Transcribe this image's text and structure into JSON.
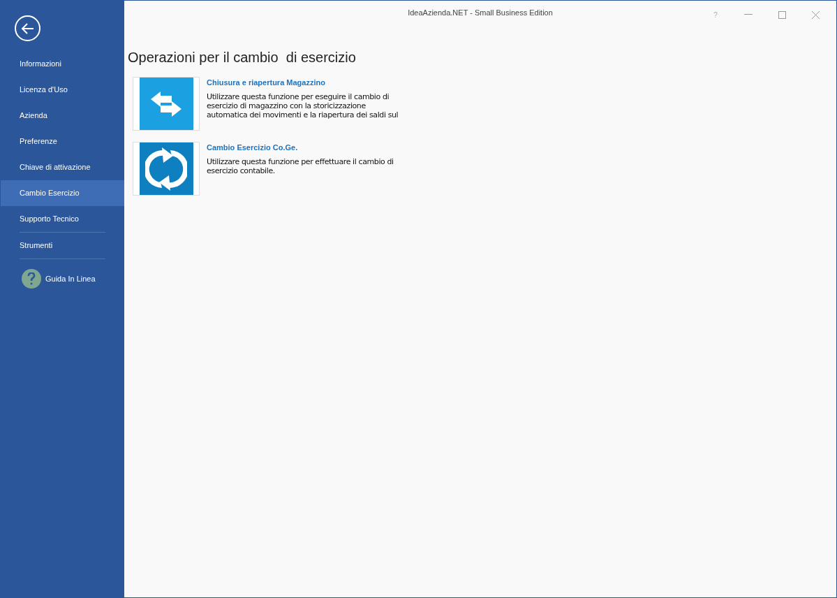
{
  "window": {
    "title": "IdeaAzienda.NET - Small Business Edition",
    "help_button": "?"
  },
  "sidebar": {
    "items": [
      {
        "label": "Informazioni",
        "selected": false,
        "divider_below": false
      },
      {
        "label": "Licenza d'Uso",
        "selected": false,
        "divider_below": false
      },
      {
        "label": "Azienda",
        "selected": false,
        "divider_below": false
      },
      {
        "label": "Preferenze",
        "selected": false,
        "divider_below": false
      },
      {
        "label": "Chiave di attivazione",
        "selected": false,
        "divider_below": false
      },
      {
        "label": "Cambio Esercizio",
        "selected": true,
        "divider_below": false
      },
      {
        "label": "Supporto Tecnico",
        "selected": false,
        "divider_below": true
      },
      {
        "label": "Strumenti",
        "selected": false,
        "divider_below": true
      }
    ],
    "help_link": "Guida In Linea"
  },
  "content": {
    "heading": "Operazioni per il cambio  di esercizio",
    "operations": [
      {
        "kind": "swap",
        "title": "Chiusura e riapertura Magazzino",
        "description": "Utilizzare questa funzione per eseguire il cambio di esercizio di magazzino con la storicizzazione automatica dei movimenti e la riapertura dei saldi sul"
      },
      {
        "kind": "refresh",
        "title": "Cambio Esercizio Co.Ge.",
        "description": "Utilizzare questa funzione per effettuare il cambio di esercizio contabile."
      }
    ]
  }
}
